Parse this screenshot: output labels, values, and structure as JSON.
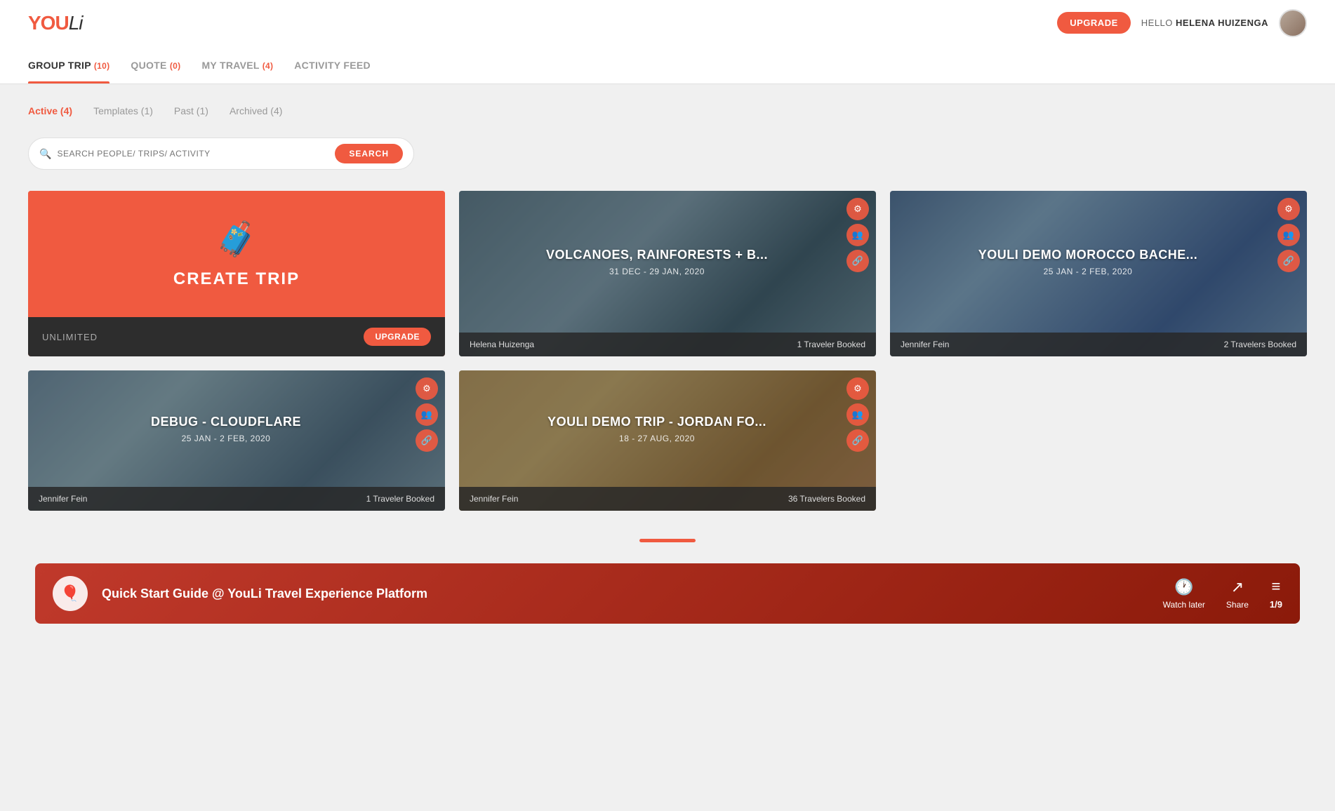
{
  "header": {
    "logo": "YOULi",
    "upgrade_label": "UPGRADE",
    "hello_prefix": "HELLO",
    "user_name": "HELENA HUIZENGA"
  },
  "main_nav": {
    "tabs": [
      {
        "id": "group_trip",
        "label": "GROUP TRIP",
        "count": "10",
        "active": true
      },
      {
        "id": "quote",
        "label": "QUOTE",
        "count": "0",
        "active": false
      },
      {
        "id": "my_travel",
        "label": "MY TRAVEL",
        "count": "4",
        "active": false
      },
      {
        "id": "activity_feed",
        "label": "ACTIVITY FEED",
        "count": null,
        "active": false
      }
    ]
  },
  "sub_tabs": [
    {
      "id": "active",
      "label": "Active",
      "count": "4",
      "active": true
    },
    {
      "id": "templates",
      "label": "Templates",
      "count": "1",
      "active": false
    },
    {
      "id": "past",
      "label": "Past",
      "count": "1",
      "active": false
    },
    {
      "id": "archived",
      "label": "Archived",
      "count": "4",
      "active": false
    }
  ],
  "search": {
    "placeholder": "SEARCH PEOPLE/ TRIPS/ ACTIVITY",
    "button_label": "SEARCH"
  },
  "create_card": {
    "icon": "🧳",
    "label": "CREATE TRIP",
    "bottom_text": "UNLIMITED",
    "upgrade_label": "UPGRADE"
  },
  "trip_cards": [
    {
      "id": "volcanoes",
      "title": "VOLCANOES, RAINFORESTS + B...",
      "dates": "31 DEC - 29 JAN, 2020",
      "organizer": "Helena Huizenga",
      "travelers": "1 Traveler Booked",
      "bg_class": "bg-pattern-mountain"
    },
    {
      "id": "morocco",
      "title": "YOULI DEMO MOROCCO BACHE...",
      "dates": "25 JAN - 2 FEB, 2020",
      "organizer": "Jennifer Fein",
      "travelers": "2 Travelers Booked",
      "bg_class": "bg-pattern-blue"
    },
    {
      "id": "cloudflare",
      "title": "DEBUG - CLOUDFLARE",
      "dates": "25 JAN - 2 FEB, 2020",
      "organizer": "Jennifer Fein",
      "travelers": "1 Traveler Booked",
      "bg_class": "bg-pattern-cloudflare"
    },
    {
      "id": "jordan",
      "title": "YOULI DEMO TRIP - JORDAN FO...",
      "dates": "18 - 27 AUG, 2020",
      "organizer": "Jennifer Fein",
      "travelers": "36 Travelers Booked",
      "bg_class": "bg-pattern-desert"
    }
  ],
  "video_bar": {
    "title": "Quick Start Guide @ YouLi Travel Experience Platform",
    "watch_later": "Watch later",
    "share": "Share",
    "count": "1/9"
  }
}
